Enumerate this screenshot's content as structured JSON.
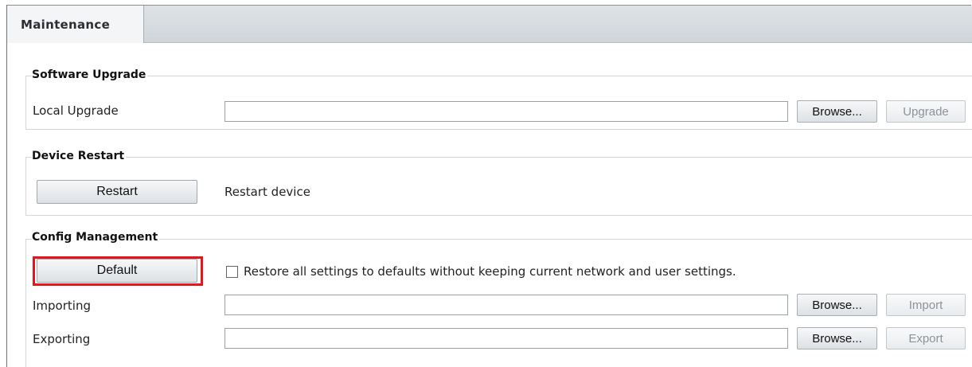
{
  "tab": {
    "label": "Maintenance"
  },
  "software_upgrade": {
    "title": "Software Upgrade",
    "local_upgrade_label": "Local Upgrade",
    "local_upgrade_value": "",
    "browse_label": "Browse...",
    "upgrade_label": "Upgrade"
  },
  "device_restart": {
    "title": "Device Restart",
    "restart_label": "Restart",
    "restart_desc": "Restart device"
  },
  "config_management": {
    "title": "Config Management",
    "default_label": "Default",
    "restore_checkbox_label": "Restore all settings to defaults without keeping current network and user settings.",
    "restore_checked": false,
    "importing_label": "Importing",
    "importing_value": "",
    "import_browse_label": "Browse...",
    "import_label": "Import",
    "exporting_label": "Exporting",
    "exporting_value": "",
    "export_browse_label": "Browse...",
    "export_label": "Export"
  },
  "colors": {
    "highlight": "#e8141b"
  }
}
